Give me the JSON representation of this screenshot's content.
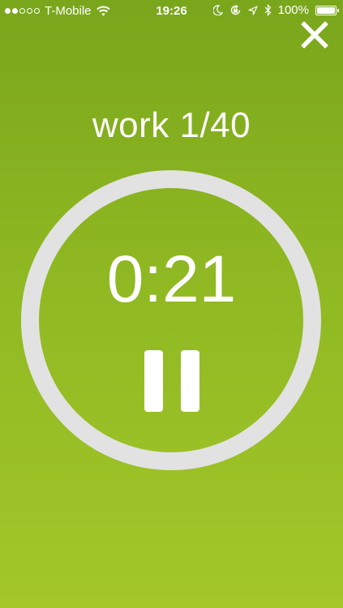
{
  "status_bar": {
    "carrier": "T-Mobile",
    "time": "19:26",
    "battery": "100%",
    "signal_filled": 2,
    "signal_total": 5
  },
  "interval": {
    "label": "work 1/40"
  },
  "timer": {
    "remaining": "0:21"
  },
  "colors": {
    "background_top": "#7aa61c",
    "background_bottom": "#a3c72a",
    "ring": "#e2e2e2",
    "foreground": "#ffffff"
  },
  "icons": [
    "wifi-icon",
    "moon-icon",
    "rotation-lock-icon",
    "location-icon",
    "bluetooth-icon",
    "battery-icon",
    "close-icon",
    "pause-icon"
  ]
}
